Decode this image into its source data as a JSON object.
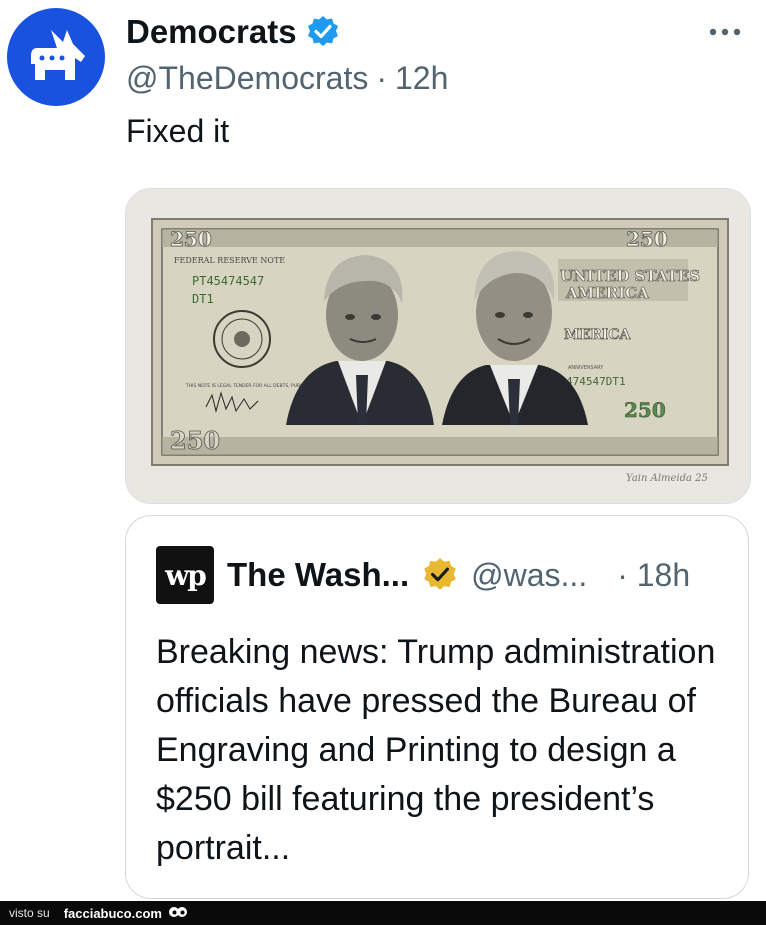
{
  "tweet": {
    "author_name": "Democrats",
    "author_handle": "@TheDemocrats",
    "separator": "·",
    "time": "12h",
    "text": "Fixed it",
    "avatar_icon": "donkey-icon",
    "verified_icon": "blue-verified-badge-icon",
    "more_icon": "more-dots-icon"
  },
  "media": {
    "bill_denomination": "250",
    "bill_serial": "PT45474547",
    "bill_letters": "DT1",
    "bill_serial_right": "474547DT1",
    "bill_header": "FEDERAL RESERVE NOTE",
    "bill_country_line1": "UNITED STATES",
    "bill_country_line2": "AMERICA",
    "bill_side_word": "MERICA",
    "bill_anniversary": "ANNIVERSARY",
    "bill_legal_tender": "THIS NOTE IS LEGAL TENDER FOR ALL DEBTS, PUBLIC AND",
    "artist_signature": "Yain Almeida 25"
  },
  "quote": {
    "logo_text": "wp",
    "name": "The Wash...",
    "handle": "@was...",
    "separator": "·",
    "time": "18h",
    "verified_icon": "gold-verified-badge-icon",
    "text": "Breaking news: Trump administration officials have pressed the Bureau of Engraving and Printing to design a $250 bill featuring the president’s portrait..."
  },
  "footer": {
    "visto": "visto su",
    "site": "facciabuco.com",
    "mascot_icon": "eyes-icon"
  },
  "colors": {
    "brand_blue": "#1a52e0",
    "verified_blue": "#1d9bf0",
    "verified_gold": "#e8b830",
    "secondary_text": "#536471",
    "bill_green": "#5b8a4f"
  }
}
